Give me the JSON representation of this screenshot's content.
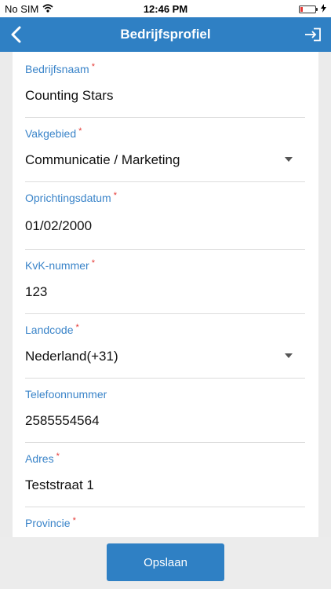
{
  "status_bar": {
    "carrier": "No SIM",
    "time": "12:46 PM"
  },
  "header": {
    "title": "Bedrijfsprofiel",
    "back_icon": "chevron-left-icon",
    "exit_icon": "exit-arrow-icon"
  },
  "form": {
    "fields": [
      {
        "label": "Bedrijfsnaam",
        "required": "*",
        "value": "Counting Stars",
        "type": "text"
      },
      {
        "label": "Vakgebied",
        "required": "*",
        "value": "Communicatie / Marketing",
        "type": "select"
      },
      {
        "label": "Oprichtingsdatum",
        "required": "*",
        "value": "01/02/2000",
        "type": "date"
      },
      {
        "label": "KvK-nummer",
        "required": "*",
        "value": "123",
        "type": "text"
      },
      {
        "label": "Landcode",
        "required": "*",
        "value": "Nederland(+31)",
        "type": "select"
      },
      {
        "label": "Telefoonnummer",
        "value": "2585554564",
        "type": "text"
      },
      {
        "label": "Adres",
        "required": "*",
        "value": "Teststraat 1",
        "type": "text"
      },
      {
        "label": "Provincie",
        "required": "*",
        "value": "",
        "type": "select"
      }
    ]
  },
  "footer": {
    "save_label": "Opslaan"
  },
  "colors": {
    "primary": "#2f80c4",
    "label": "#3a84c9",
    "required": "#e53935"
  }
}
